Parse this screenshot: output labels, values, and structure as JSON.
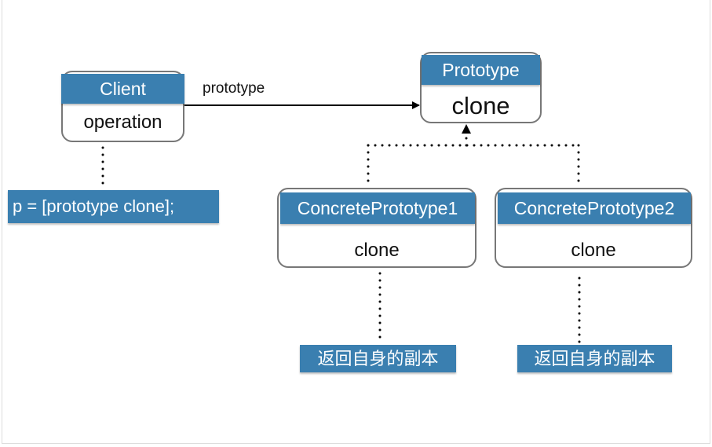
{
  "colors": {
    "accent": "#3a7fb0",
    "border": "#777777"
  },
  "client": {
    "name": "Client",
    "operation": "operation"
  },
  "association": {
    "label": "prototype"
  },
  "prototype": {
    "name": "Prototype",
    "method": "clone"
  },
  "concrete1": {
    "name": "ConcretePrototype1",
    "method": "clone"
  },
  "concrete2": {
    "name": "ConcretePrototype2",
    "method": "clone"
  },
  "notes": {
    "client": "p = [prototype clone];",
    "concrete1": "返回自身的副本",
    "concrete2": "返回自身的副本"
  }
}
